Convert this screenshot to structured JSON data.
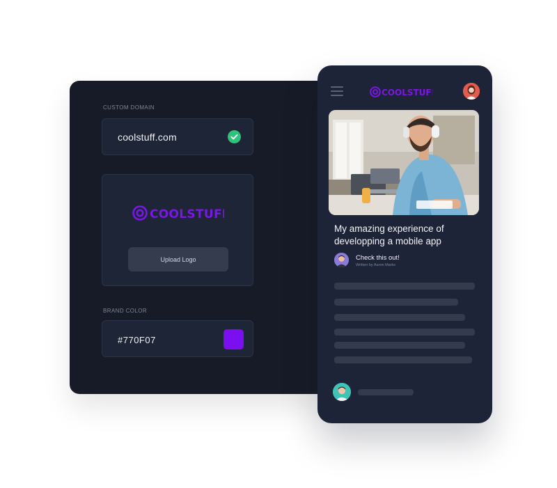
{
  "brand": {
    "name": "COOLSTUFF",
    "color": "#770F07",
    "swatch_color": "#7a0ff0",
    "accent_color": "#7a16e6",
    "success_color": "#2fc27a"
  },
  "settings": {
    "custom_domain_label": "CUSTOM DOMAIN",
    "domain_value": "coolstuff.com",
    "upload_logo_label": "Upload Logo",
    "brand_color_label": "BRAND COLOR",
    "brand_color_value": "#770F07"
  },
  "phone": {
    "post_title": "My amazing experience of developping a mobile app",
    "author_headline": "Check this out!",
    "author_byline": "Written by Aaron Marks"
  },
  "icons": [
    "check-circle-icon",
    "coolstuff-logo-icon",
    "hamburger-menu-icon",
    "avatar-icon"
  ]
}
